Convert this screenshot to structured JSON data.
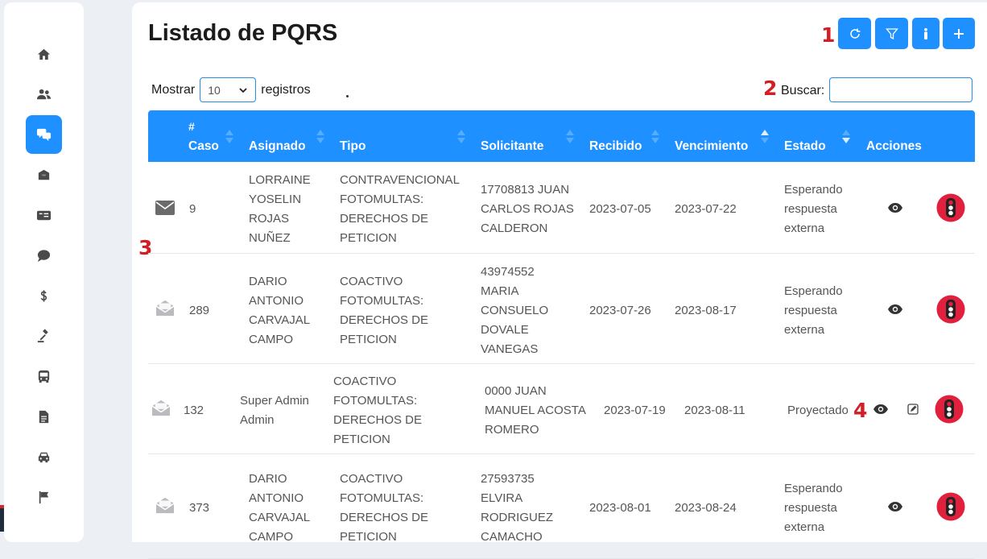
{
  "page": {
    "title": "Listado de PQRS"
  },
  "annotations": [
    "1",
    "2",
    "3",
    "4"
  ],
  "toolbar": {
    "refresh_icon": "refresh-icon",
    "filter_icon": "filter-icon",
    "info_icon": "info-icon",
    "add_icon": "plus-icon"
  },
  "sidebar": {
    "items": [
      {
        "icon": "home-icon",
        "active": false
      },
      {
        "icon": "users-icon",
        "active": false
      },
      {
        "icon": "pqrs-chat-icon",
        "active": true
      },
      {
        "icon": "inbox-icon",
        "active": false
      },
      {
        "icon": "id-card-icon",
        "active": false
      },
      {
        "icon": "money-chat-icon",
        "active": false
      },
      {
        "icon": "dollar-icon",
        "active": false
      },
      {
        "icon": "gavel-icon",
        "active": false
      },
      {
        "icon": "bus-icon",
        "active": false
      },
      {
        "icon": "document-icon",
        "active": false
      },
      {
        "icon": "car-icon",
        "active": false
      },
      {
        "icon": "flag-icon",
        "active": false
      }
    ]
  },
  "length": {
    "prefix": "Mostrar",
    "value": "10",
    "suffix": "registros"
  },
  "search": {
    "label": "Buscar:",
    "value": ""
  },
  "table": {
    "headers": {
      "caso_top": "#",
      "caso": "Caso",
      "asignado": "Asignado",
      "tipo": "Tipo",
      "solicitante": "Solicitante",
      "recibido": "Recibido",
      "vencimiento": "Vencimiento",
      "estado": "Estado",
      "acciones": "Acciones"
    },
    "rows": [
      {
        "read": false,
        "caso": "9",
        "asignado": [
          "LORRAINE",
          "YOSELIN",
          "ROJAS",
          "NUÑEZ"
        ],
        "tipo": [
          "CONTRAVENCIONAL",
          "FOTOMULTAS:",
          "DERECHOS DE",
          "PETICION"
        ],
        "solicitante": [
          "17708813 JUAN",
          "CARLOS ROJAS",
          "CALDERON"
        ],
        "recibido": "2023-07-05",
        "vencimiento": "2023-07-22",
        "estado": [
          "Esperando",
          "respuesta",
          "externa"
        ],
        "editable": false
      },
      {
        "read": true,
        "caso": "289",
        "asignado": [
          "DARIO",
          "ANTONIO",
          "CARVAJAL",
          "CAMPO"
        ],
        "tipo": [
          "COACTIVO",
          "FOTOMULTAS:",
          "DERECHOS DE",
          "PETICION"
        ],
        "solicitante": [
          "43974552",
          "MARIA",
          "CONSUELO",
          "DOVALE",
          "VANEGAS"
        ],
        "recibido": "2023-07-26",
        "vencimiento": "2023-08-17",
        "estado": [
          "Esperando",
          "respuesta",
          "externa"
        ],
        "editable": false
      },
      {
        "read": true,
        "caso": "132",
        "asignado": [
          "Super Admin",
          "Admin"
        ],
        "tipo": [
          "COACTIVO",
          "FOTOMULTAS:",
          "DERECHOS DE",
          "PETICION"
        ],
        "solicitante": [
          "0000 JUAN",
          "MANUEL ACOSTA",
          "ROMERO"
        ],
        "recibido": "2023-07-19",
        "vencimiento": "2023-08-11",
        "estado": [
          "Proyectado"
        ],
        "editable": true
      },
      {
        "read": true,
        "caso": "373",
        "asignado": [
          "DARIO",
          "ANTONIO",
          "CARVAJAL",
          "CAMPO"
        ],
        "tipo": [
          "COACTIVO",
          "FOTOMULTAS:",
          "DERECHOS DE",
          "PETICION"
        ],
        "solicitante": [
          "27593735",
          "ELVIRA",
          "RODRIGUEZ",
          "CAMACHO"
        ],
        "recibido": "2023-08-01",
        "vencimiento": "2023-08-24",
        "estado": [
          "Esperando",
          "respuesta",
          "externa"
        ],
        "editable": false
      }
    ]
  },
  "colors": {
    "primary": "#1e90ff",
    "annotation": "#d21f26",
    "traffic_light": "#e0203c"
  }
}
